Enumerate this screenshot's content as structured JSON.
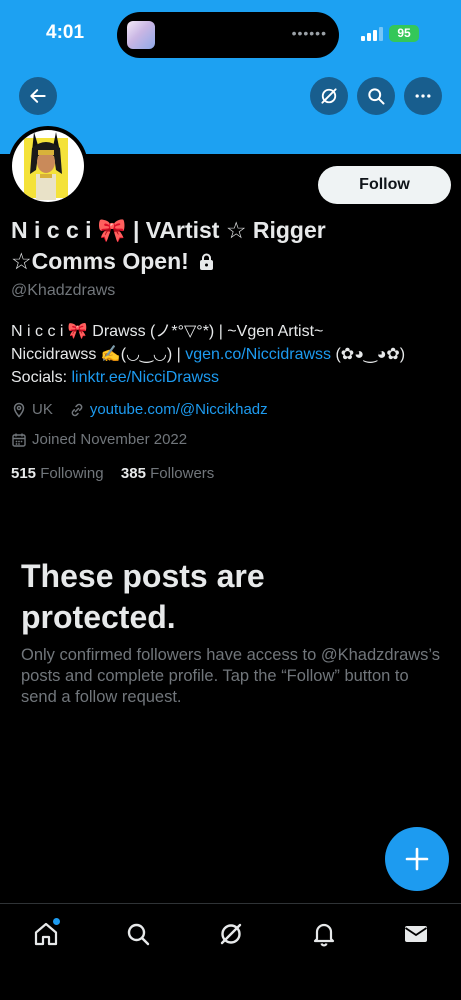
{
  "status_bar": {
    "time": "4:01",
    "battery": "95"
  },
  "profile": {
    "display_name": "N i c c i 🎀 | VArtist ☆ Rigger ☆Comms Open!",
    "handle": "@Khadzdraws",
    "follow_label": "Follow",
    "bio_line1": "N i c c i 🎀 Drawss (ノ*°▽°*) | ~Vgen Artist~",
    "bio_line2_text": "Niccidrawss ✍️(◡‿◡) | ",
    "bio_line2_link": "vgen.co/Niccidrawss",
    "bio_line2_suffix": " (✿◕‿◕✿)",
    "bio_line3_text": "Socials: ",
    "bio_line3_link": "linktr.ee/NicciDrawss",
    "location": "UK",
    "website": "youtube.com/@Niccikhadz",
    "joined": "Joined November 2022",
    "following_count": "515",
    "following_label": "Following",
    "followers_count": "385",
    "followers_label": "Followers"
  },
  "protected": {
    "title": "These posts are protected.",
    "body": "Only confirmed followers have access to @Khadzdraws’s posts and complete profile. Tap the “Follow” button to send a follow request."
  },
  "colors": {
    "accent": "#1d9bf0",
    "banner": "#1da1f2",
    "background": "#000000",
    "muted": "#71767b"
  },
  "icons": [
    "back-arrow-icon",
    "grok-icon",
    "search-icon",
    "more-icon",
    "lock-icon",
    "location-icon",
    "link-icon",
    "calendar-icon",
    "plus-icon",
    "home-icon",
    "notifications-icon",
    "messages-icon"
  ],
  "tabs": [
    {
      "name": "home",
      "has_badge": true
    },
    {
      "name": "search",
      "has_badge": false
    },
    {
      "name": "grok",
      "has_badge": false
    },
    {
      "name": "notifications",
      "has_badge": false
    },
    {
      "name": "messages",
      "has_badge": false
    }
  ]
}
